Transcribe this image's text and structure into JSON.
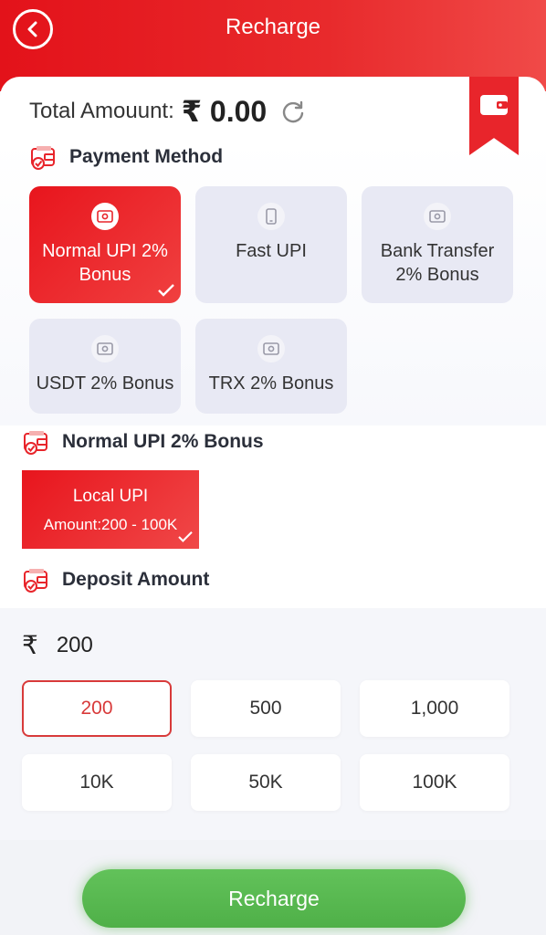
{
  "header": {
    "title": "Recharge"
  },
  "balance": {
    "label": "Total Amouunt:",
    "value": "₹ 0.00"
  },
  "payment_method": {
    "title": "Payment Method",
    "options": [
      {
        "label": "Normal UPI 2% Bonus",
        "selected": true
      },
      {
        "label": "Fast UPI",
        "selected": false
      },
      {
        "label": "Bank Transfer 2% Bonus",
        "selected": false
      },
      {
        "label": "USDT 2% Bonus",
        "selected": false
      },
      {
        "label": "TRX 2% Bonus",
        "selected": false
      }
    ]
  },
  "channel": {
    "title": "Normal UPI 2% Bonus",
    "name": "Local UPI",
    "range": "Amount:200 - 100K"
  },
  "deposit": {
    "title": "Deposit Amount",
    "currency": "₹",
    "value": "200",
    "presets": [
      "200",
      "500",
      "1,000",
      "10K",
      "50K",
      "100K"
    ],
    "selected_index": 0
  },
  "actions": {
    "recharge": "Recharge"
  },
  "colors": {
    "accent": "#e8151d",
    "green": "#56b54e"
  }
}
